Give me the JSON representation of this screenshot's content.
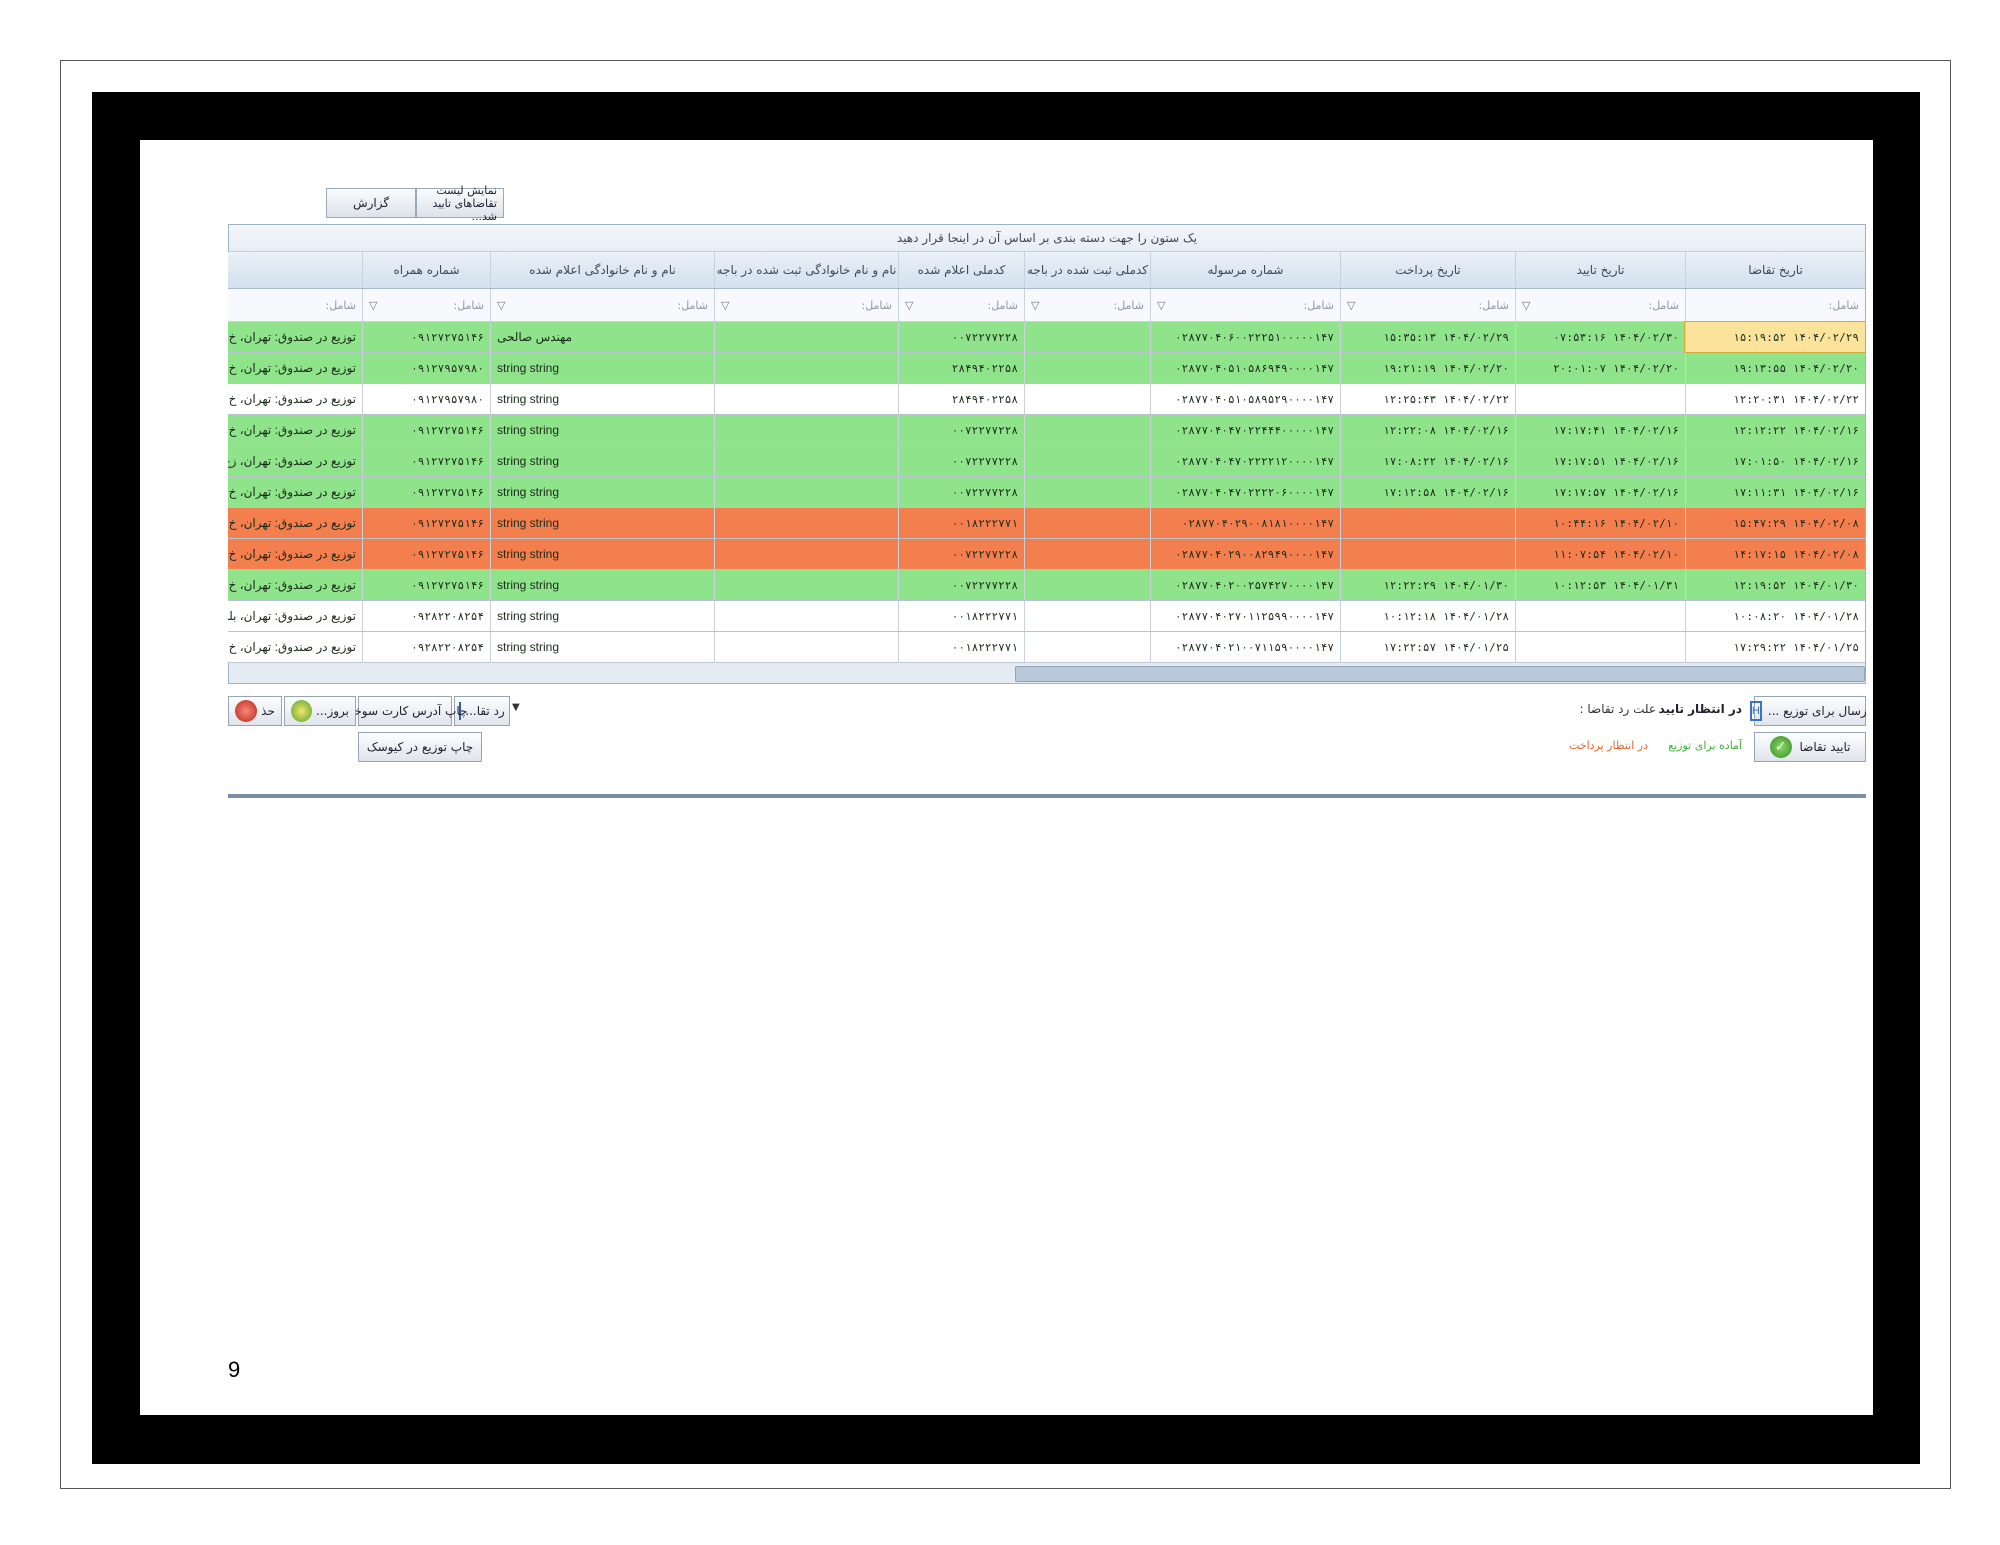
{
  "page": {
    "number": "9"
  },
  "top_buttons": {
    "report": "گزارش",
    "show_confirmed": "نمایش لیست تقاضاهای تایید شد..."
  },
  "grid": {
    "group_hint": "یک ستون را جهت دسته بندی بر اساس آن در اینجا قرار دهید",
    "filter_placeholder": "شامل:",
    "columns": [
      "تاریخ تقاضا",
      "تاریخ تایید",
      "تاریخ پرداخت",
      "شماره مرسوله",
      "کدملی ثبت شده در باجه",
      "کدملی اعلام شده",
      "نام و نام خانوادگی ثبت شده در باجه",
      "نام و نام خانوادگی اعلام شده",
      "شماره همراه",
      ""
    ],
    "rows": [
      {
        "status": "green",
        "cells": [
          "۱۴۰۴/۰۲/۲۹ ۱۵:۱۹:۵۲",
          "۱۴۰۴/۰۲/۳۰ ۰۷:۵۳:۱۶",
          "۱۴۰۴/۰۲/۲۹ ۱۵:۳۵:۱۳",
          "۰۲۸۷۷۰۴۰۶۰۰۲۲۲۵۱۰۰۰۰۰۱۴۷",
          "",
          "۰۰۷۲۲۷۷۲۲۸",
          "",
          "مهندس صالحی",
          "۰۹۱۲۷۲۷۵۱۴۶",
          "توزیع در صندوق: تهران، خ"
        ]
      },
      {
        "status": "green",
        "cells": [
          "۱۴۰۴/۰۲/۲۰ ۱۹:۱۳:۵۵",
          "۱۴۰۴/۰۲/۲۰ ۲۰:۰۱:۰۷",
          "۱۴۰۴/۰۲/۲۰ ۱۹:۲۱:۱۹",
          "۰۲۸۷۷۰۴۰۵۱۰۵۸۶۹۴۹۰۰۰۰۱۴۷",
          "",
          "۲۸۴۹۴۰۲۲۵۸",
          "",
          "string string",
          "۰۹۱۲۷۹۵۷۹۸۰",
          "توزیع در صندوق: تهران، خ"
        ]
      },
      {
        "status": "white",
        "cells": [
          "۱۴۰۴/۰۲/۲۲ ۱۲:۲۰:۳۱",
          "",
          "۱۴۰۴/۰۲/۲۲ ۱۲:۲۵:۴۳",
          "۰۲۸۷۷۰۴۰۵۱۰۵۸۹۵۲۹۰۰۰۰۱۴۷",
          "",
          "۲۸۴۹۴۰۲۲۵۸",
          "",
          "string string",
          "۰۹۱۲۷۹۵۷۹۸۰",
          "توزیع در صندوق: تهران، خ"
        ]
      },
      {
        "status": "green",
        "cells": [
          "۱۴۰۴/۰۲/۱۶ ۱۲:۱۲:۲۲",
          "۱۴۰۴/۰۲/۱۶ ۱۷:۱۷:۴۱",
          "۱۴۰۴/۰۲/۱۶ ۱۲:۲۲:۰۸",
          "۰۲۸۷۷۰۴۰۴۷۰۲۲۴۴۴۰۰۰۰۰۱۴۷",
          "",
          "۰۰۷۲۲۷۷۲۲۸",
          "",
          "string string",
          "۰۹۱۲۷۲۷۵۱۴۶",
          "توزیع در صندوق: تهران، خ"
        ]
      },
      {
        "status": "green",
        "cells": [
          "۱۴۰۴/۰۲/۱۶ ۱۷:۰۱:۵۰",
          "۱۴۰۴/۰۲/۱۶ ۱۷:۱۷:۵۱",
          "۱۴۰۴/۰۲/۱۶ ۱۷:۰۸:۲۲",
          "۰۲۸۷۷۰۴۰۴۷۰۲۲۲۲۱۲۰۰۰۰۱۴۷",
          "",
          "۰۰۷۲۲۷۷۲۲۸",
          "",
          "string string",
          "۰۹۱۲۷۲۷۵۱۴۶",
          "توزیع در صندوق: تهران، زع"
        ]
      },
      {
        "status": "green",
        "cells": [
          "۱۴۰۴/۰۲/۱۶ ۱۷:۱۱:۳۱",
          "۱۴۰۴/۰۲/۱۶ ۱۷:۱۷:۵۷",
          "۱۴۰۴/۰۲/۱۶ ۱۷:۱۲:۵۸",
          "۰۲۸۷۷۰۴۰۴۷۰۲۲۲۲۰۶۰۰۰۰۱۴۷",
          "",
          "۰۰۷۲۲۷۷۲۲۸",
          "",
          "string string",
          "۰۹۱۲۷۲۷۵۱۴۶",
          "توزیع در صندوق: تهران، خ"
        ]
      },
      {
        "status": "orange",
        "cells": [
          "۱۴۰۴/۰۲/۰۸ ۱۵:۴۷:۲۹",
          "۱۴۰۴/۰۲/۱۰ ۱۰:۴۴:۱۶",
          "",
          "۰۲۸۷۷۰۴۰۲۹۰۰۸۱۸۱۰۰۰۰۱۴۷",
          "",
          "۰۰۱۸۲۲۲۷۷۱",
          "",
          "string string",
          "۰۹۱۲۷۲۷۵۱۴۶",
          "توزیع در صندوق: تهران، خ"
        ]
      },
      {
        "status": "orange",
        "cells": [
          "۱۴۰۴/۰۲/۰۸ ۱۴:۱۷:۱۵",
          "۱۴۰۴/۰۲/۱۰ ۱۱:۰۷:۵۴",
          "",
          "۰۲۸۷۷۰۴۰۲۹۰۰۸۲۹۴۹۰۰۰۰۱۴۷",
          "",
          "۰۰۷۲۲۷۷۲۲۸",
          "",
          "string string",
          "۰۹۱۲۷۲۷۵۱۴۶",
          "توزیع در صندوق: تهران، خ"
        ]
      },
      {
        "status": "green",
        "cells": [
          "۱۴۰۴/۰۱/۳۰ ۱۲:۱۹:۵۲",
          "۱۴۰۴/۰۱/۳۱ ۱۰:۱۲:۵۳",
          "۱۴۰۴/۰۱/۳۰ ۱۲:۲۲:۲۹",
          "۰۲۸۷۷۰۴۰۲۰۰۲۵۷۴۲۷۰۰۰۰۱۴۷",
          "",
          "۰۰۷۲۲۷۷۲۲۸",
          "",
          "string string",
          "۰۹۱۲۷۲۷۵۱۴۶",
          "توزیع در صندوق: تهران، خ"
        ]
      },
      {
        "status": "white",
        "cells": [
          "۱۴۰۴/۰۱/۲۸ ۱۰:۰۸:۲۰",
          "",
          "۱۴۰۴/۰۱/۲۸ ۱۰:۱۲:۱۸",
          "۰۲۸۷۷۰۴۰۲۷۰۱۱۲۵۹۹۰۰۰۰۱۴۷",
          "",
          "۰۰۱۸۲۲۲۷۷۱",
          "",
          "string string",
          "۰۹۲۸۲۲۰۸۲۵۴",
          "توزیع در صندوق: تهران، بلو"
        ]
      },
      {
        "status": "white",
        "cells": [
          "۱۴۰۴/۰۱/۲۵ ۱۷:۲۹:۲۲",
          "",
          "۱۴۰۴/۰۱/۲۵ ۱۷:۲۲:۵۷",
          "۰۲۸۷۷۰۴۰۲۱۰۰۷۱۱۵۹۰۰۰۰۱۴۷",
          "",
          "۰۰۱۸۲۲۲۷۷۱",
          "",
          "string string",
          "۰۹۲۸۲۲۰۸۲۵۴",
          "توزیع در صندوق: تهران، خ"
        ]
      }
    ]
  },
  "bottom": {
    "send_for_distribution": "ارسال برای توزیع ...",
    "confirm_request": "تایید تقاضا",
    "awaiting_confirm": "در انتظار تایید",
    "reject_reason_label": "علت رد تقاضا :",
    "ready_for_distribution": "آماده برای توزیع",
    "awaiting_payment": "در انتظار پرداخت",
    "reject_button": "رد تقا...",
    "print_fuel_card": "چاپ آدرس کارت سوخت",
    "update_button": "بروز...",
    "kiosk_print": "چاپ توزیع در کیوسک",
    "clear_button": "حذ"
  },
  "colors": {
    "green": "#8fe38a",
    "orange": "#f47f4e",
    "selected": "#fbe39c",
    "waiting_payment": "#e0662b",
    "ready": "#3fae3a"
  },
  "icons": [
    "funnel-icon",
    "dropdown-arrow-icon",
    "distribution-icon",
    "check-icon",
    "reject-icon",
    "refresh-icon",
    "delete-icon"
  ]
}
